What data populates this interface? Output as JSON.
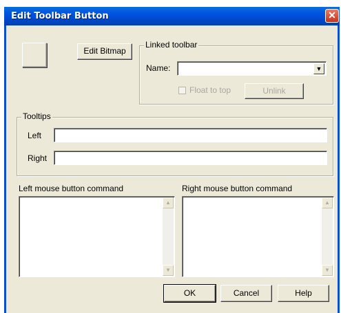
{
  "window": {
    "title": "Edit Toolbar Button",
    "close_glyph": "✕"
  },
  "buttons": {
    "edit_bitmap": "Edit Bitmap",
    "unlink": "Unlink",
    "ok": "OK",
    "cancel": "Cancel",
    "help": "Help"
  },
  "linked_toolbar": {
    "group_label": "Linked toolbar",
    "name_label": "Name:",
    "name_value": "",
    "float_label": "Float to top",
    "float_checked": false
  },
  "tooltips": {
    "group_label": "Tooltips",
    "left_label": "Left",
    "left_value": "",
    "right_label": "Right",
    "right_value": ""
  },
  "commands": {
    "left_label": "Left mouse button command",
    "left_value": "",
    "right_label": "Right mouse button command",
    "right_value": ""
  },
  "icons": {
    "dropdown": "chevron-down-icon",
    "scroll_up": "scroll-up-arrow-icon",
    "scroll_down": "scroll-down-arrow-icon",
    "close": "close-icon"
  },
  "colors": {
    "titlebar": "#0054e3",
    "dialog_bg": "#ece9d8",
    "close_button": "#c8321d"
  }
}
